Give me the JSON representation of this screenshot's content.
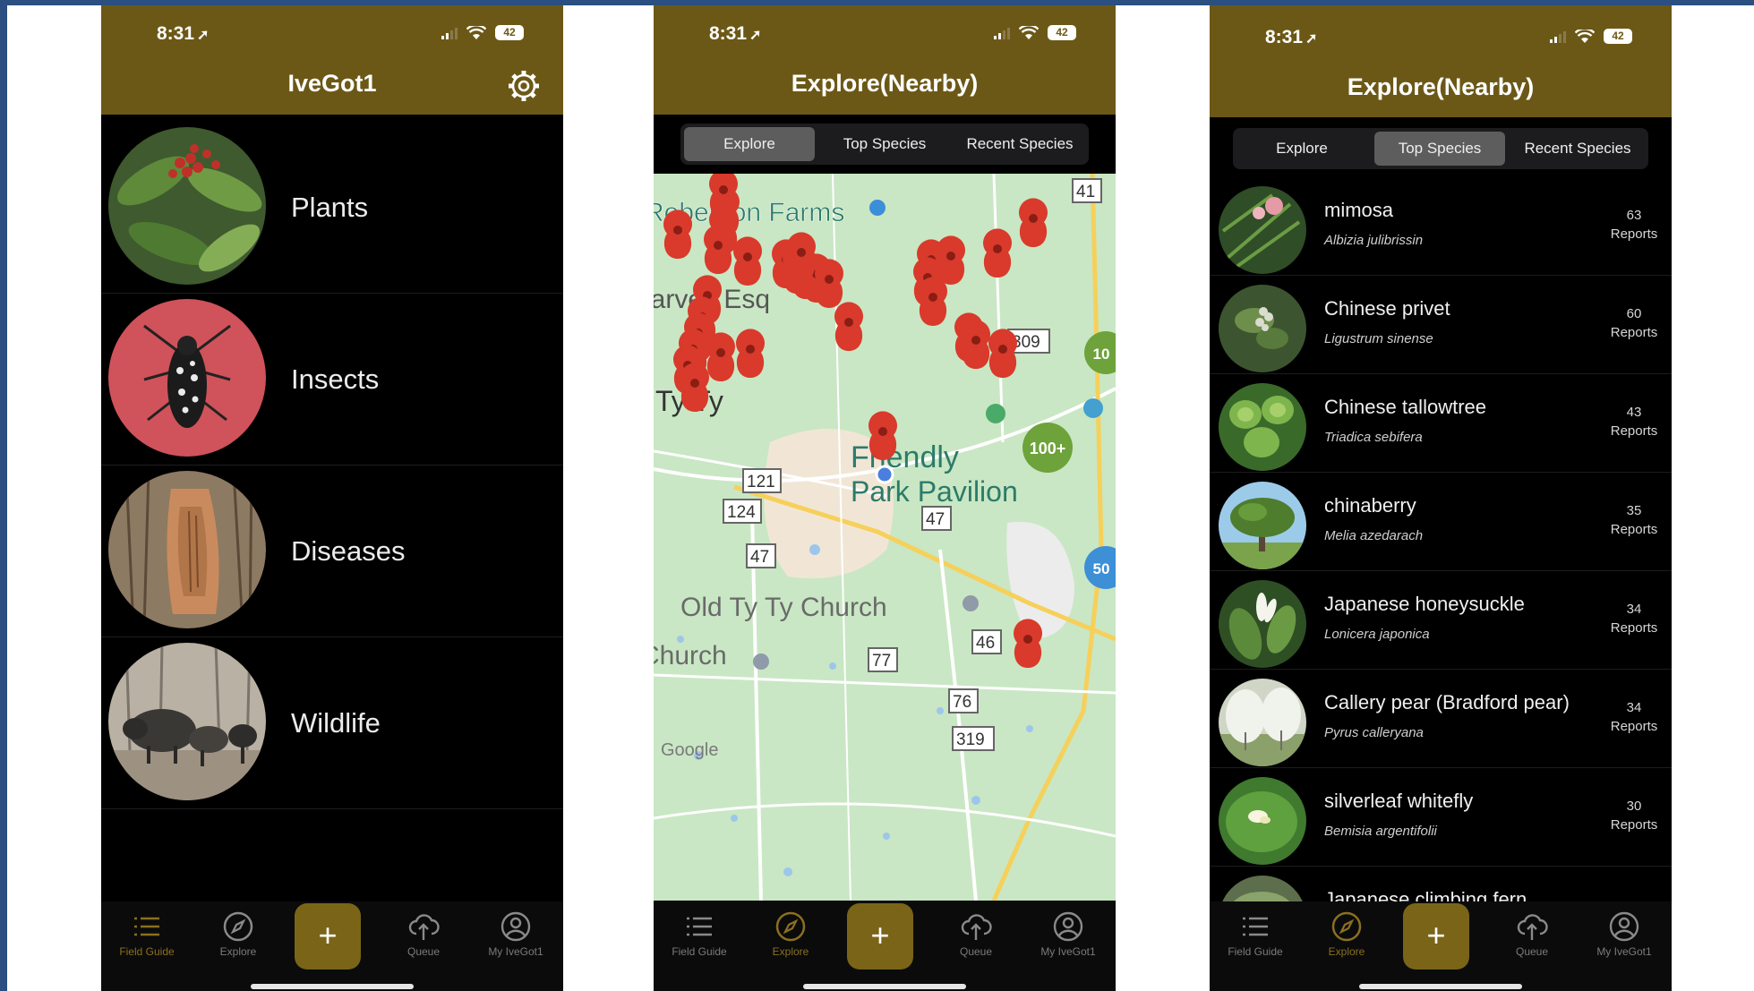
{
  "status": {
    "time": "8:31",
    "battery": "42"
  },
  "phone1": {
    "title": "IveGot1",
    "categories": [
      {
        "label": "Plants",
        "image": "plants-photo"
      },
      {
        "label": "Insects",
        "image": "insects-photo"
      },
      {
        "label": "Diseases",
        "image": "diseases-photo"
      },
      {
        "label": "Wildlife",
        "image": "wildlife-photo"
      }
    ]
  },
  "phone2": {
    "title": "Explore(Nearby)",
    "segments": [
      "Explore",
      "Top Species",
      "Recent Species"
    ],
    "active_segment": "Explore",
    "map": {
      "labels": {
        "farms": "Roberson Farms",
        "esq": "Harvey Esq",
        "tyty": "Ty Ty",
        "friendly": "Friendly",
        "pavilion": "Park Pavilion",
        "church": "Old Ty Ty Church",
        "church2": "Church",
        "google": "Google"
      },
      "route_shields": [
        "41",
        "309",
        "121",
        "124",
        "47",
        "47",
        "46",
        "77",
        "76",
        "319"
      ],
      "clusters": [
        "100+",
        "10",
        "50"
      ]
    }
  },
  "phone3": {
    "title": "Explore(Nearby)",
    "segments": [
      "Explore",
      "Top Species",
      "Recent Species"
    ],
    "active_segment": "Top Species",
    "species": [
      {
        "name": "mimosa",
        "scientific": "Albizia julibrissin",
        "count": "63",
        "unit": "Reports"
      },
      {
        "name": "Chinese privet",
        "scientific": "Ligustrum sinense",
        "count": "60",
        "unit": "Reports"
      },
      {
        "name": "Chinese tallowtree",
        "scientific": "Triadica sebifera",
        "count": "43",
        "unit": "Reports"
      },
      {
        "name": "chinaberry",
        "scientific": "Melia azedarach",
        "count": "35",
        "unit": "Reports"
      },
      {
        "name": "Japanese honeysuckle",
        "scientific": "Lonicera japonica",
        "count": "34",
        "unit": "Reports"
      },
      {
        "name": "Callery pear (Bradford pear)",
        "scientific": "Pyrus calleryana",
        "count": "34",
        "unit": "Reports"
      },
      {
        "name": "silverleaf whitefly",
        "scientific": "Bemisia argentifolii",
        "count": "30",
        "unit": "Reports"
      },
      {
        "name": "Japanese climbing fern",
        "scientific": "",
        "count": "",
        "unit": ""
      }
    ]
  },
  "tabs": [
    {
      "label": "Field Guide",
      "icon": "list-icon"
    },
    {
      "label": "Explore",
      "icon": "compass-icon"
    },
    {
      "label": "+",
      "icon": "plus-icon"
    },
    {
      "label": "Queue",
      "icon": "cloud-upload-icon"
    },
    {
      "label": "My IveGot1",
      "icon": "user-circle-icon"
    }
  ],
  "colors": {
    "header": "#6c5816",
    "accent": "#7a6418",
    "background": "#000000",
    "map": "#c9e7c4",
    "pin": "#d93a2b"
  }
}
